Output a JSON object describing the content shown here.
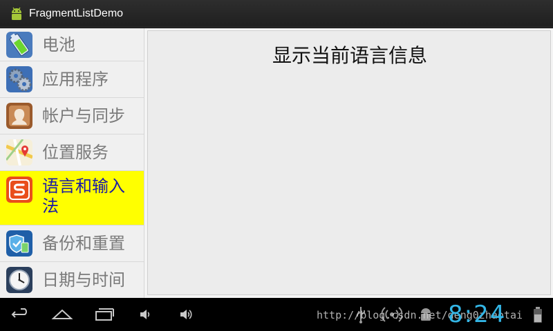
{
  "app": {
    "title": "FragmentListDemo",
    "icon": "android-icon"
  },
  "list": {
    "items": [
      {
        "label": "电池",
        "icon": "battery-icon",
        "selected": false
      },
      {
        "label": "应用程序",
        "icon": "gears-icon",
        "selected": false
      },
      {
        "label": "帐户与同步",
        "icon": "account-icon",
        "selected": false
      },
      {
        "label": "位置服务",
        "icon": "map-icon",
        "selected": false
      },
      {
        "label": "语言和输入法",
        "icon": "sogou-icon",
        "selected": true
      },
      {
        "label": "备份和重置",
        "icon": "backup-shield-icon",
        "selected": false
      },
      {
        "label": "日期与时间",
        "icon": "clock-icon",
        "selected": false
      }
    ],
    "selected_color": "#ffff00",
    "selected_text_color": "#1a1aa6"
  },
  "detail": {
    "title": "显示当前语言信息"
  },
  "navbar": {
    "clock": "8:24",
    "watermark": "http://blog.csdn.net/deng0zhaotai",
    "clock_color": "#33b5e5"
  }
}
